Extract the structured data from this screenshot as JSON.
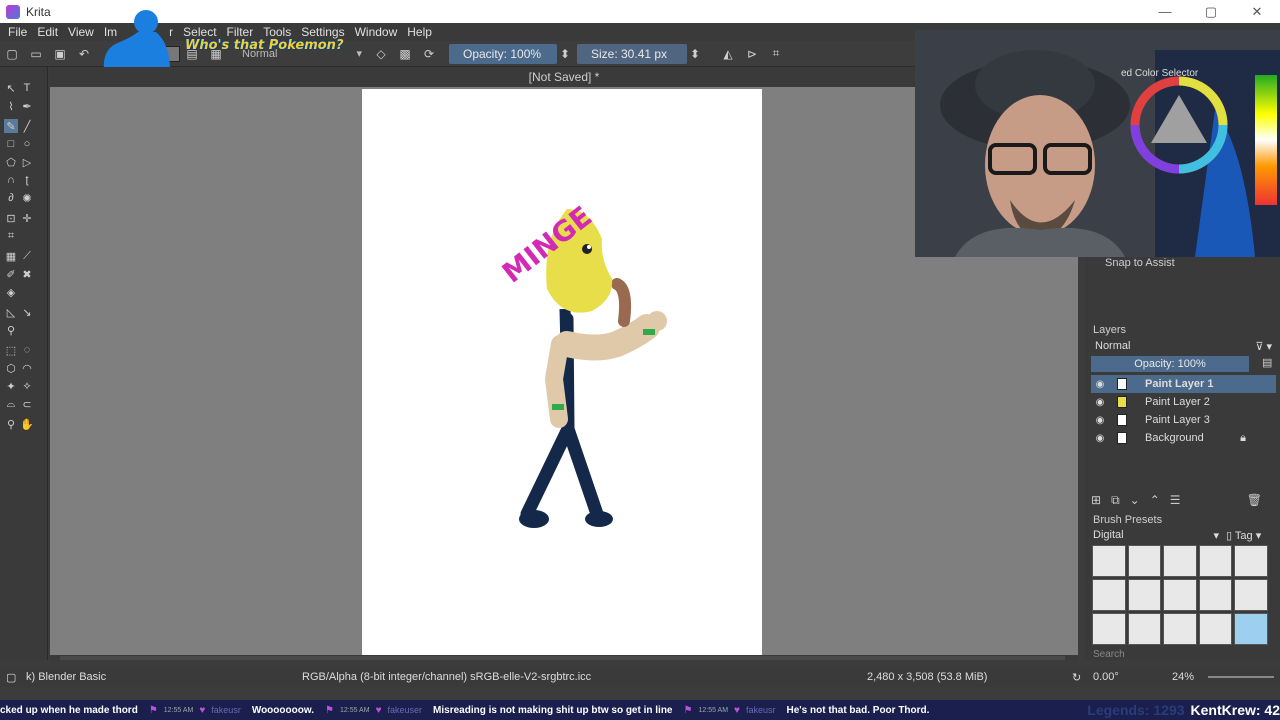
{
  "window": {
    "title": "Krita",
    "min": "—",
    "max": "▢",
    "close": "✕"
  },
  "menu": [
    "File",
    "Edit",
    "View",
    "Im",
    "",
    "r",
    "Select",
    "Filter",
    "Tools",
    "Settings",
    "Window",
    "Help"
  ],
  "toolbar": {
    "blend_mode": "Normal",
    "opacity": "Opacity: 100%",
    "size": "Size: 30.41 px",
    "overlay_text": "Who's that Pokemon?"
  },
  "document": {
    "title": "[Not Saved]  *"
  },
  "canvas_text": "MINGE",
  "panels": {
    "color_selector": "ed Color Selector",
    "snap": "Snap to Assist",
    "layers_title": "Layers",
    "layers_mode": "Normal",
    "layers_opacity": "Opacity:  100%",
    "layers": [
      "Paint Layer 1",
      "Paint Layer 2",
      "Paint Layer 3",
      "Background"
    ],
    "brush_presets_title": "Brush Presets",
    "preset_group": "Digital",
    "tag": "Tag",
    "search": "Search"
  },
  "status": {
    "brush": "k) Blender Basic",
    "color_space": "RGB/Alpha (8-bit integer/channel)  sRGB-elle-V2-srgbtrc.icc",
    "dimensions": "2,480 x 3,508 (53.8 MiB)",
    "rotation": "0.00°",
    "zoom": "24%"
  },
  "ticker": {
    "m1": "cked up when he made thord",
    "t1": "12:55 AM",
    "u1": "fakeusr",
    "m2": "Wooooooow.",
    "t2": "12:55 AM",
    "u2": "fakeuser",
    "m3": "Misreading is not making shit up btw so get in line",
    "t3": "12:55 AM",
    "u3": "fakeusr",
    "m4": "He's not that bad.  Poor Thord.",
    "legends": "Legends: 1293",
    "krew": "KentKrew: 42"
  },
  "colors": {
    "accent": "#4b6a8c",
    "canvas_bg": "#7f7f7f",
    "panel": "#3a3a3a"
  }
}
